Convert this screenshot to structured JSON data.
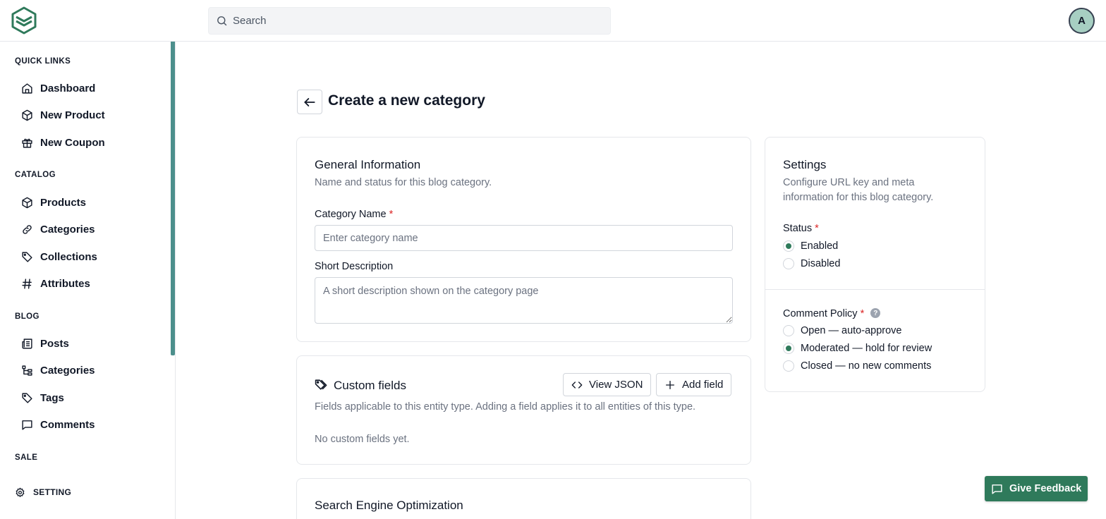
{
  "header": {
    "search_placeholder": "Search",
    "avatar_initial": "A"
  },
  "sidebar": {
    "sections": {
      "quick_links": "QUICK LINKS",
      "catalog": "CATALOG",
      "blog": "BLOG",
      "sale": "SALE"
    },
    "quick_links": [
      {
        "label": "Dashboard",
        "icon": "home-icon"
      },
      {
        "label": "New Product",
        "icon": "box-icon"
      },
      {
        "label": "New Coupon",
        "icon": "gift-icon"
      }
    ],
    "catalog": [
      {
        "label": "Products",
        "icon": "box-icon"
      },
      {
        "label": "Categories",
        "icon": "link-icon"
      },
      {
        "label": "Collections",
        "icon": "tag-icon"
      },
      {
        "label": "Attributes",
        "icon": "hash-icon"
      }
    ],
    "blog": [
      {
        "label": "Posts",
        "icon": "newspaper-icon"
      },
      {
        "label": "Categories",
        "icon": "tree-icon"
      },
      {
        "label": "Tags",
        "icon": "tag-icon"
      },
      {
        "label": "Comments",
        "icon": "message-icon"
      }
    ],
    "setting_label": "SETTING"
  },
  "main": {
    "title": "Create a new category",
    "general": {
      "title": "General Information",
      "subtitle": "Name and status for this blog category.",
      "name_label": "Category Name",
      "name_placeholder": "Enter category name",
      "desc_label": "Short Description",
      "desc_placeholder": "A short description shown on the category page",
      "required_mark": "*"
    },
    "custom_fields": {
      "title": "Custom fields",
      "view_json": "View JSON",
      "add_field": "Add field",
      "subtitle": "Fields applicable to this entity type. Adding a field applies it to all entities of this type.",
      "empty": "No custom fields yet."
    },
    "seo": {
      "title": "Search Engine Optimization"
    },
    "settings": {
      "title": "Settings",
      "subtitle_line1": "Configure URL key and meta",
      "subtitle_line2": "information for this blog category.",
      "status_label": "Status",
      "status_options": [
        {
          "label": "Enabled",
          "checked": true
        },
        {
          "label": "Disabled",
          "checked": false
        }
      ],
      "comment_label": "Comment Policy",
      "help_glyph": "?",
      "comment_options": [
        {
          "label": "Open — auto-approve",
          "checked": false
        },
        {
          "label": "Moderated — hold for review",
          "checked": true
        },
        {
          "label": "Closed — no new comments",
          "checked": false
        }
      ]
    }
  },
  "feedback_label": "Give Feedback",
  "colors": {
    "accent": "#2f7a5b",
    "scrollbar": "#4c8f8c",
    "avatar_bg": "#a7cfc2",
    "required": "#dc2626"
  }
}
